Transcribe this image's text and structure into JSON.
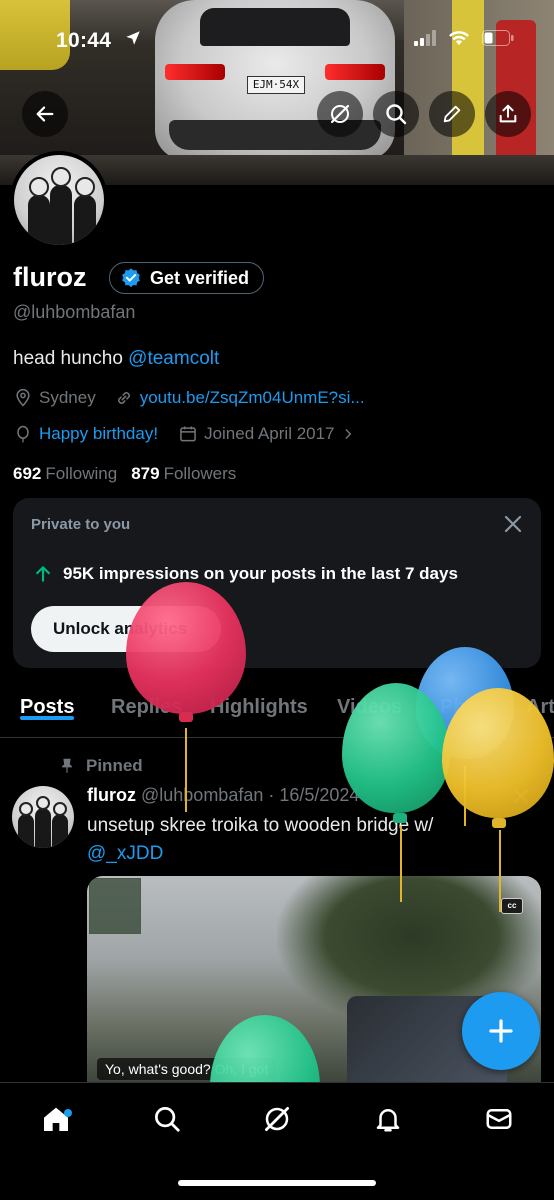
{
  "status_bar": {
    "time": "10:44"
  },
  "banner": {
    "plate_text": "EJM·54X"
  },
  "profile": {
    "name": "fluroz",
    "verify_label": "Get verified",
    "handle": "@luhbombafan",
    "bio_text": "head huncho ",
    "bio_mention": "@teamcolt",
    "location": "Sydney",
    "website": "youtu.be/ZsqZm04UnmE?si...",
    "birthday": "Happy birthday!",
    "joined": "Joined April 2017",
    "following_count": "692",
    "following_label": "Following",
    "followers_count": "879",
    "followers_label": "Followers"
  },
  "private_card": {
    "title": "Private to you",
    "impressions_text": "95K impressions on your posts in the last 7 days",
    "unlock_label": "Unlock analytics"
  },
  "tabs": [
    {
      "label": "Posts",
      "active": true
    },
    {
      "label": "Replies"
    },
    {
      "label": "Highlights"
    },
    {
      "label": "Videos"
    },
    {
      "label": "Ph"
    },
    {
      "label": "Art"
    }
  ],
  "post": {
    "pinned_label": "Pinned",
    "author": "fluroz",
    "handle_date": "@luhbombafan · 16/5/2024",
    "text": "unsetup skree troika to wooden bridge w/ ",
    "mention": "@_xJDD",
    "subtitle": "Yo, what's good? Oh, I got",
    "cc_label": "cc"
  },
  "colors": {
    "accent": "#1d9bf0",
    "impressions_arrow": "#00ba7c",
    "balloon_pink": "#e8335f",
    "balloon_green": "#22c48a",
    "balloon_blue": "#3a94e6",
    "balloon_yellow": "#f0c12a"
  },
  "icons": {
    "back": "arrow-left-icon",
    "grok": "grok-icon",
    "search": "search-icon",
    "edit": "pencil-icon",
    "share": "share-icon",
    "nav": [
      "home-icon",
      "search-icon",
      "grok-icon",
      "bell-icon",
      "mail-icon"
    ]
  }
}
